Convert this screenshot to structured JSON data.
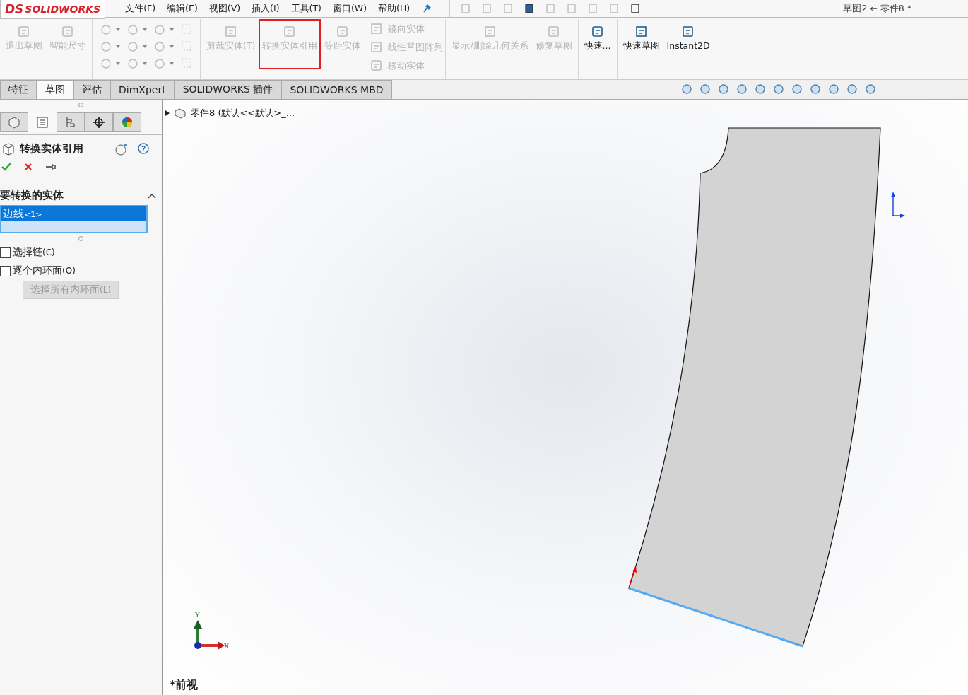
{
  "app": {
    "logo_mark": "DS",
    "logo": "SOLIDWORKS"
  },
  "menu": [
    "文件(F)",
    "编辑(E)",
    "视图(V)",
    "插入(I)",
    "工具(T)",
    "窗口(W)",
    "帮助(H)"
  ],
  "window": {
    "title": "草图2 ← 零件8 *"
  },
  "ribbon": {
    "groups": [
      {
        "kind": "large",
        "items": [
          {
            "label": "退出草图",
            "disabled": true,
            "highlighted": false
          },
          {
            "label": "智能尺寸",
            "disabled": true,
            "highlighted": false
          }
        ]
      },
      {
        "kind": "grid"
      },
      {
        "kind": "large",
        "items": [
          {
            "label": "剪裁实体(T)",
            "disabled": true,
            "highlighted": false
          },
          {
            "label": "转换实体引用",
            "disabled": true,
            "highlighted": true
          },
          {
            "label": "等距实体",
            "disabled": true,
            "highlighted": false
          }
        ]
      },
      {
        "kind": "small",
        "items": [
          {
            "label": "镜向实体",
            "disabled": true
          },
          {
            "label": "线性草图阵列",
            "disabled": true
          },
          {
            "label": "移动实体",
            "disabled": true
          }
        ]
      },
      {
        "kind": "large",
        "items": [
          {
            "label": "显示/删除几何关系",
            "disabled": true,
            "highlighted": false
          },
          {
            "label": "修复草图",
            "disabled": true,
            "highlighted": false
          }
        ]
      },
      {
        "kind": "large",
        "items": [
          {
            "label": "快速...",
            "disabled": false,
            "highlighted": false
          }
        ]
      },
      {
        "kind": "large",
        "items": [
          {
            "label": "快速草图",
            "disabled": false,
            "highlighted": false
          },
          {
            "label": "Instant2D",
            "disabled": false,
            "highlighted": false
          }
        ]
      }
    ]
  },
  "tabs": [
    {
      "label": "特征",
      "selected": false
    },
    {
      "label": "草图",
      "selected": true
    },
    {
      "label": "评估",
      "selected": false
    },
    {
      "label": "DimXpert",
      "selected": false
    },
    {
      "label": "SOLIDWORKS 插件",
      "selected": false
    },
    {
      "label": "SOLIDWORKS MBD",
      "selected": false
    }
  ],
  "panel_tabs": [
    {
      "selected": false
    },
    {
      "selected": true
    },
    {
      "selected": false
    },
    {
      "selected": false
    },
    {
      "selected": false
    }
  ],
  "property_manager": {
    "title": "转换实体引用",
    "section": {
      "title": "要转换的实体",
      "expanded": true,
      "list": [
        {
          "label": "边线",
          "suffix": "<1>",
          "selected": true
        }
      ]
    },
    "checkboxes": [
      {
        "label": "选择链",
        "shortcut": "(C)",
        "checked": false
      },
      {
        "label": "逐个内环面",
        "shortcut": "(O)",
        "checked": false
      }
    ],
    "button": {
      "label": "选择所有内环面",
      "shortcut": "(L)",
      "disabled": true
    }
  },
  "tree": {
    "root": "零件8 (默认<<默认>_...",
    "expanded": false
  },
  "viewport": {
    "view_label": "*前视",
    "axis_y": "Y",
    "axis_x": "X"
  }
}
